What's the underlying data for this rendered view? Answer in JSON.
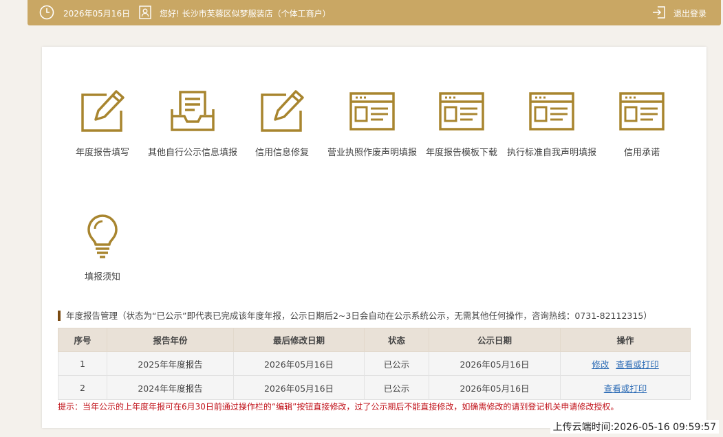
{
  "header": {
    "date": "2026年05月16日",
    "greeting": "您好! 长沙市芙蓉区似梦服装店（个体工商户）",
    "logout_label": "退出登录"
  },
  "colors": {
    "brand": "#c9a764",
    "icon": "#a8852f",
    "tip": "#c1121a"
  },
  "tiles": [
    {
      "label": "年度报告填写",
      "icon": "edit-report-icon"
    },
    {
      "label": "其他自行公示信息填报",
      "icon": "inbox-document-icon"
    },
    {
      "label": "信用信息修复",
      "icon": "edit-report-icon"
    },
    {
      "label": "营业执照作废声明填报",
      "icon": "browser-window-icon"
    },
    {
      "label": "年度报告模板下载",
      "icon": "browser-window-icon"
    },
    {
      "label": "执行标准自我声明填报",
      "icon": "browser-window-icon"
    },
    {
      "label": "信用承诺",
      "icon": "browser-window-icon"
    },
    {
      "label": "填报须知",
      "icon": "lightbulb-icon"
    }
  ],
  "section": {
    "title": "年度报告管理（状态为“已公示”即代表已完成该年度年报，公示日期后2~3日会自动在公示系统公示，无需其他任何操作，咨询热线：0731-82112315）"
  },
  "table": {
    "headers": [
      "序号",
      "报告年份",
      "最后修改日期",
      "状态",
      "公示日期",
      "操作"
    ],
    "rows": [
      {
        "no": "1",
        "year": "2025年年度报告",
        "modified": "2026年05月16日",
        "status": "已公示",
        "published": "2026年05月16日",
        "actions": [
          "修改",
          "查看或打印"
        ]
      },
      {
        "no": "2",
        "year": "2024年年度报告",
        "modified": "2026年05月16日",
        "status": "已公示",
        "published": "2026年05月16日",
        "actions": [
          "查看或打印"
        ]
      }
    ]
  },
  "tip": "提示：当年公示的上年度年报可在6月30日前通过操作栏的“编辑”按钮直接修改，过了公示期后不能直接修改，如确需修改的请到登记机关申请修改授权。",
  "upload_time": "上传云端时间:2026-05-16 09:59:57"
}
